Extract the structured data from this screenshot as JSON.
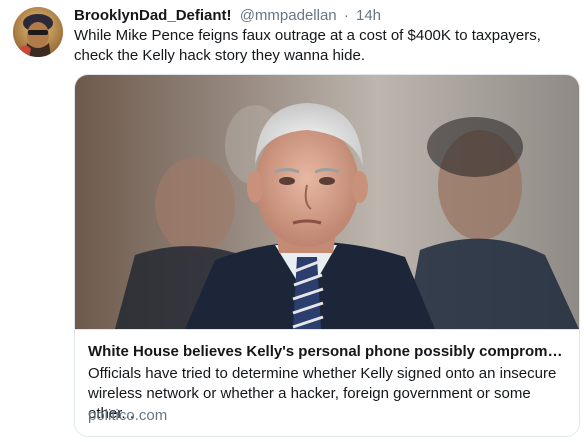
{
  "tweet": {
    "author_name": "BrooklynDad_Defiant!",
    "author_handle": "@mmpadellan",
    "separator": "·",
    "time": "14h",
    "text": "While Mike Pence feigns faux outrage at a cost of $400K to taxpayers, check the Kelly hack story they wanna hide."
  },
  "card": {
    "title": "White House believes Kelly's personal phone possibly compromised ...",
    "description": "Officials have tried to determine whether Kelly signed onto an insecure wireless network or whether a hacker, foreign government or some other...",
    "domain": "politico.com"
  },
  "colors": {
    "text": "#14171a",
    "secondary": "#657786",
    "border": "#e1e8ed"
  }
}
